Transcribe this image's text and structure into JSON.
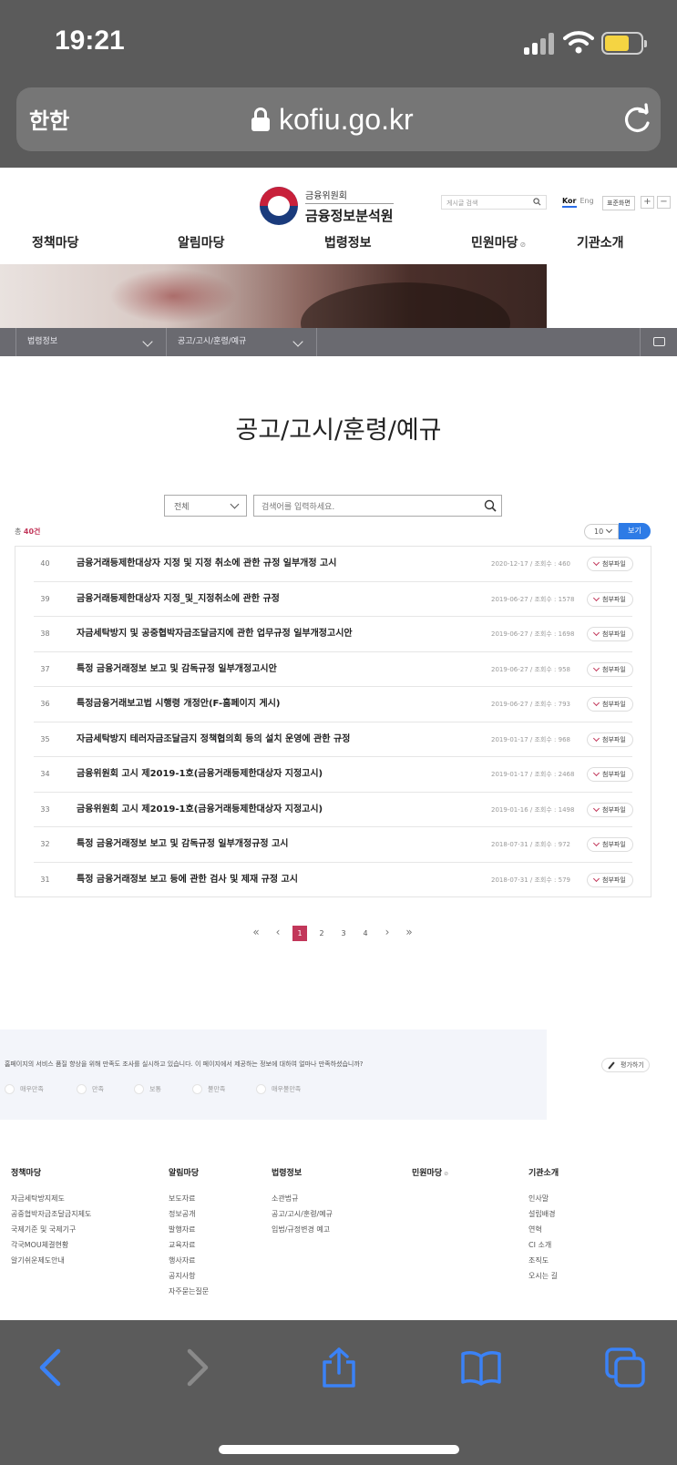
{
  "status_bar": {
    "time": "19:21"
  },
  "browser": {
    "aa_label": "한한",
    "url": "kofiu.go.kr"
  },
  "header": {
    "org_small": "금융위원회",
    "org_name": "금융정보분석원",
    "search_placeholder": "게시글 검색",
    "lang_kor": "Kor",
    "lang_eng": "Eng",
    "std_screen": "표준화면",
    "zoom_in": "+",
    "zoom_out": "−"
  },
  "gnb": [
    "정책마당",
    "알림마당",
    "법령정보",
    "민원마당",
    "기관소개"
  ],
  "breadcrumb": {
    "level1": "법령정보",
    "level2": "공고/고시/훈령/예규"
  },
  "page": {
    "title": "공고/고시/훈령/예규"
  },
  "search": {
    "category": "전체",
    "placeholder": "검색어를 입력하세요."
  },
  "list_meta": {
    "total_prefix": "총",
    "total_count": "40건",
    "per_page": "10",
    "view_label": "보기"
  },
  "attach_label": "첨부파일",
  "rows": [
    {
      "no": "40",
      "title": "금융거래등제한대상자 지정 및 지정 취소에 관한 규정 일부개정 고시",
      "meta": "2020-12-17 / 조회수 : 460"
    },
    {
      "no": "39",
      "title": "금융거래등제한대상자 지정_및_지정취소에 관한 규정",
      "meta": "2019-06-27 / 조회수 : 1578"
    },
    {
      "no": "38",
      "title": "자금세탁방지 및 공중협박자금조달금지에 관한 업무규정 일부개정고시안",
      "meta": "2019-06-27 / 조회수 : 1698"
    },
    {
      "no": "37",
      "title": "특정 금융거래정보 보고 및 감독규정 일부개정고시안",
      "meta": "2019-06-27 / 조회수 : 958"
    },
    {
      "no": "36",
      "title": "특정금융거래보고법 시행령 개정안(F-홈페이지 게시)",
      "meta": "2019-06-27 / 조회수 : 793"
    },
    {
      "no": "35",
      "title": "자금세탁방지 테러자금조달금지 정책협의회 등의 설치 운영에 관한 규정",
      "meta": "2019-01-17 / 조회수 : 968"
    },
    {
      "no": "34",
      "title": "금융위원회 고시 제2019-1호(금융거래등제한대상자 지정고시)",
      "meta": "2019-01-17 / 조회수 : 2468"
    },
    {
      "no": "33",
      "title": "금융위원회 고시 제2019-1호(금융거래등제한대상자 지정고시)",
      "meta": "2019-01-16 / 조회수 : 1498"
    },
    {
      "no": "32",
      "title": "특정 금융거래정보 보고 및 감독규정 일부개정규정 고시",
      "meta": "2018-07-31 / 조회수 : 972"
    },
    {
      "no": "31",
      "title": "특정 금융거래정보 보고 등에 관한 검사 및 제재 규정 고시",
      "meta": "2018-07-31 / 조회수 : 579"
    }
  ],
  "pagination": {
    "first": "«",
    "prev": "‹",
    "pages": [
      "1",
      "2",
      "3",
      "4"
    ],
    "current": "1",
    "next": "›",
    "last": "»"
  },
  "survey": {
    "question": "홈페이지의 서비스 품질 향상을 위해 만족도 조사를 실시하고 있습니다. 이 페이지에서 제공하는 정보에 대하여 얼마나 만족하셨습니까?",
    "options": [
      "매우만족",
      "만족",
      "보통",
      "불만족",
      "매우불만족"
    ],
    "rate_button": "평가하기"
  },
  "footer": {
    "columns": [
      {
        "head": "정책마당",
        "links": [
          "자금세탁방지제도",
          "공중협박자금조달금지제도",
          "국제기준 및 국제기구",
          "각국MOU체결현황",
          "알기쉬운제도안내"
        ]
      },
      {
        "head": "알림마당",
        "links": [
          "보도자료",
          "정보공개",
          "발행자료",
          "교육자료",
          "행사자료",
          "공지사항",
          "자주묻는질문"
        ]
      },
      {
        "head": "법령정보",
        "links": [
          "소관법규",
          "공고/고시/훈령/예규",
          "입법/규정변경 예고"
        ]
      },
      {
        "head": "민원마당",
        "links": []
      },
      {
        "head": "기관소개",
        "links": [
          "인사말",
          "설립배경",
          "연혁",
          "CI 소개",
          "조직도",
          "오시는 길"
        ]
      }
    ]
  }
}
